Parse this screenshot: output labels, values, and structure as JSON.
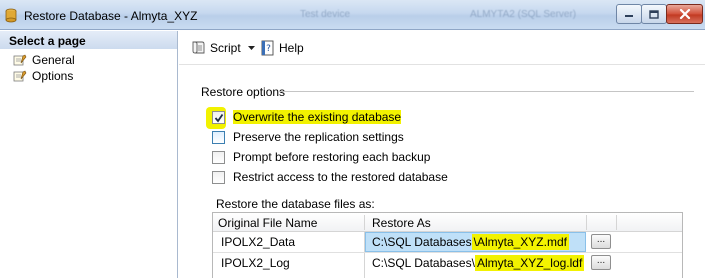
{
  "window": {
    "title": "Restore Database - Almyta_XYZ",
    "background_ghost_1": "Test device",
    "background_ghost_2": "ALMYTA2 (SQL Server)",
    "controls": [
      "minimize-icon",
      "maximize-icon",
      "close-icon"
    ]
  },
  "left_pane": {
    "header": "Select a page",
    "items": [
      {
        "label": "General",
        "icon": "page-wrench-icon"
      },
      {
        "label": "Options",
        "icon": "page-wrench-icon"
      }
    ]
  },
  "toolbar": {
    "script_label": "Script",
    "help_label": "Help"
  },
  "restore_options": {
    "title": "Restore options",
    "options": [
      {
        "label": "Overwrite the existing database",
        "checked": true
      },
      {
        "label": "Preserve the replication settings",
        "checked": false
      },
      {
        "label": "Prompt before restoring each backup",
        "checked": false
      },
      {
        "label": "Restrict access to the restored database",
        "checked": false
      }
    ]
  },
  "files": {
    "label": "Restore the database files as:",
    "columns": [
      "Original File Name",
      "Restore As"
    ],
    "rows": [
      {
        "original": "IPOLX2_Data",
        "path_prefix": "C:\\SQL Databases",
        "path_highlight": "\\Almyta_XYZ.mdf",
        "browse": "..."
      },
      {
        "original": "IPOLX2_Log",
        "path_prefix": "C:\\SQL Databases\\",
        "path_highlight": "Almyta_XYZ_log.ldf",
        "browse": "..."
      }
    ]
  },
  "colors": {
    "highlight": "#f2f200",
    "selection": "#bfe0f8",
    "titlebar": "#c6d8ef"
  }
}
